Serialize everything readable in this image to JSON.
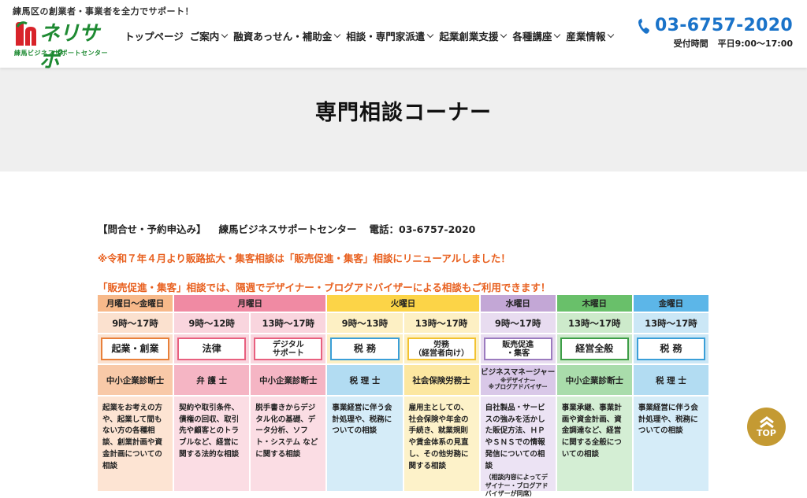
{
  "header": {
    "tagline": "練馬区の創業者・事業者を全力でサポート！",
    "logo_text": "ネリサポ",
    "logo_sub": "練馬ビジネスサポートセンター",
    "nav": [
      {
        "label": "トップページ",
        "has_dropdown": false
      },
      {
        "label": "ご案内",
        "has_dropdown": true
      },
      {
        "label": "融資あっせん・補助金",
        "has_dropdown": true
      },
      {
        "label": "相談・専門家派遣",
        "has_dropdown": true
      },
      {
        "label": "起業創業支援",
        "has_dropdown": true
      },
      {
        "label": "各種講座",
        "has_dropdown": true
      },
      {
        "label": "産業情報",
        "has_dropdown": true
      }
    ],
    "phone": "03-6757-2020",
    "hours_label": "受付時間",
    "hours": "平日9:00〜17:00"
  },
  "page_title": "専門相談コーナー",
  "contact_line": {
    "label": "【問合せ・予約申込み】",
    "center": "練馬ビジネスサポートセンター",
    "tel": "電話：03-6757-2020"
  },
  "notice1": "※令和７年４月より販路拡大・集客相談は「販売促進・集客」相談にリニューアルしました！",
  "notice2": "「販売促進・集客」相談では、隔週でデザイナー・ブログアドバイザーによる相談もご利用できます！",
  "schedule": {
    "days": [
      {
        "label": "月曜日〜金曜日",
        "color": "#f7b98a",
        "time_bg": "#fbe1cf"
      },
      {
        "label": "月曜日",
        "color": "#f08aa3",
        "time_bg": "#f9d5de"
      },
      {
        "label": "火曜日",
        "color": "#fcd447",
        "time_bg": "#fdf0c4"
      },
      {
        "label": "水曜日",
        "color": "#c3a7d6",
        "time_bg": "#e8dcf0"
      },
      {
        "label": "木曜日",
        "color": "#69c06a",
        "time_bg": "#cdeacb"
      },
      {
        "label": "金曜日",
        "color": "#5cb6e8",
        "time_bg": "#cbe7f6"
      }
    ],
    "columns": [
      {
        "time": "9時〜17時",
        "topic": "起業・創業",
        "topic_color": "#e8803a",
        "expert": "中小企業診断士",
        "expert_bg": "#f8c9a8",
        "desc_bg": "#fde4d3",
        "desc": "起業をお考えの方や、起業して間もない方の各種相談、創業計画や資金計画についての相談"
      },
      {
        "time": "9時〜12時",
        "topic": "法律",
        "topic_color": "#e8607f",
        "expert": "弁 護 士",
        "expert_bg": "#f5b5c4",
        "desc_bg": "#fbdde4",
        "desc": "契約や取引条件、債権の回収、取引先や顧客とのトラブルなど、経営に関する法的な相談"
      },
      {
        "time": "13時〜17時",
        "topic": "デジタル\nサポート",
        "topic_color": "#e8607f",
        "expert": "中小企業診断士",
        "expert_bg": "#f5b5c4",
        "desc_bg": "#fbdde4",
        "desc": "脱手書きからデジタル化の基礎、データ分析、ソフト・システム などに関する相談"
      },
      {
        "time": "9時〜13時",
        "topic": "税 務",
        "topic_color": "#3a9fd8",
        "expert": "税 理 士",
        "expert_bg": "#b2dcf2",
        "desc_bg": "#d5ecf8",
        "desc": "事業経営に伴う会計処理や、税務についての相談"
      },
      {
        "time": "13時〜17時",
        "topic": "労務\n（経営者向け）",
        "topic_color": "#f2c230",
        "expert": "社会保険労務士",
        "expert_bg": "#fce7a0",
        "desc_bg": "#fdf2c9",
        "desc": "雇用主としての、社会保険や年金の手続き、就業規則や賃金体系の見直し、その他労務に関する相談"
      },
      {
        "time": "9時〜17時",
        "topic": "販売促進\n・集客",
        "topic_color": "#9b7bbf",
        "expert": "ビジネスマネージャー",
        "expert_sub1": "※デザイナー",
        "expert_sub2": "※ブログアドバイザー",
        "expert_bg": "#d9c8e8",
        "desc_bg": "#ece3f4",
        "desc": "自社製品・サービスの強みを活かした販促方法、ＨＰやＳＮＳでの情報発信についての相談",
        "desc_note": "（相談内容によってデザイナー・ブログアドバイザーが同席）"
      },
      {
        "time": "13時〜17時",
        "topic": "経営全般",
        "topic_color": "#3e9e48",
        "expert": "中小企業診断士",
        "expert_bg": "#a9dcab",
        "desc_bg": "#d4eed4",
        "desc": "事業承継、事業計画や資金計画、資金調達など、経営に関する全般についての相談"
      },
      {
        "time": "13時〜17時",
        "topic": "税 務",
        "topic_color": "#3a9fd8",
        "expert": "税 理 士",
        "expert_bg": "#b2dcf2",
        "desc_bg": "#d5ecf8",
        "desc": "事業経営に伴う会計処理や、税務についての相談"
      }
    ]
  },
  "top_button": "TOP"
}
